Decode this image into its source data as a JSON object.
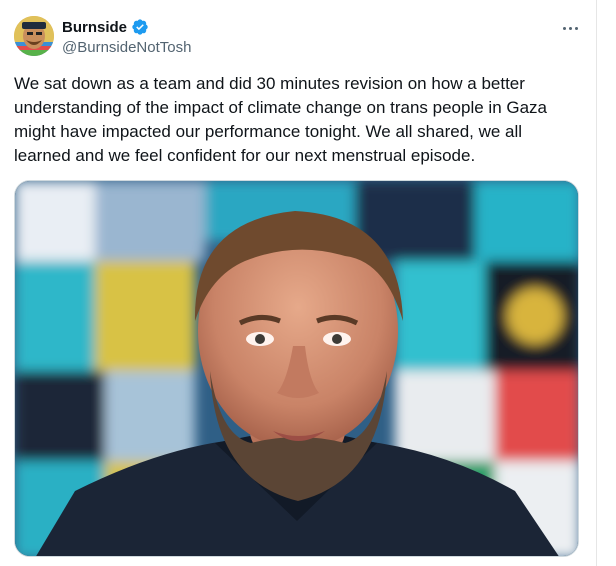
{
  "author": {
    "display_name": "Burnside",
    "handle": "@BurnsideNotTosh",
    "verified": true,
    "avatar_icon": "profile-avatar"
  },
  "tweet": {
    "text": "We sat down as a team and did 30 minutes revision on how a better understanding of the impact of climate change on trans people in Gaza might have impacted our performance tonight. We all shared, we all learned and we feel confident for our next menstrual episode."
  },
  "icons": {
    "verified": "verified-badge-icon",
    "more": "more-options-icon"
  },
  "colors": {
    "verified_blue": "#1d9bf0",
    "text_primary": "#0f1419",
    "text_secondary": "#536471",
    "border": "#cfd9de"
  }
}
